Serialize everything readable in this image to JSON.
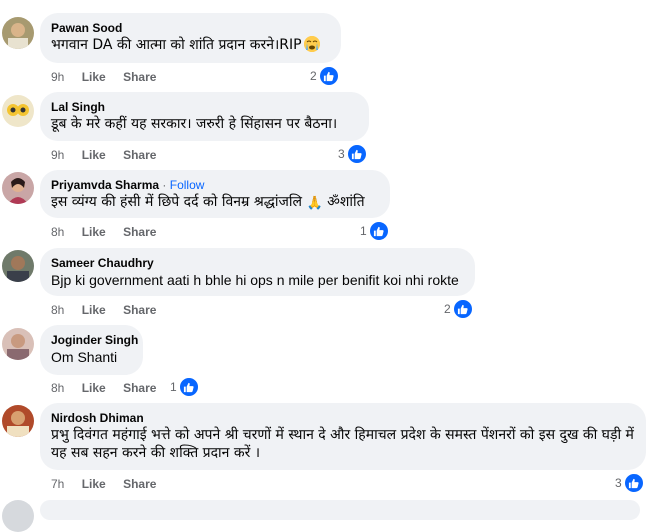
{
  "comments": [
    {
      "name": "Pawan Sood",
      "text": "भगवान DA की आत्मा को शांति प्रदान करने।RIP",
      "emoji": "crying-face",
      "time": "9h",
      "like": "Like",
      "share": "Share",
      "reactions": "2"
    },
    {
      "name": "Lal Singh",
      "text": "डूब के मरे कहीं यह सरकार। जरुरी हे सिंहासन पर बैठना।",
      "time": "9h",
      "like": "Like",
      "share": "Share",
      "reactions": "3"
    },
    {
      "name": "Priyamvda Sharma",
      "follow": "Follow",
      "dot": "·",
      "text": "इस व्यंग्य की हंसी में छिपे दर्द को विनम्र श्रद्धांजलि",
      "emoji_text": "🙏",
      "text2": "ॐशांति",
      "time": "8h",
      "like": "Like",
      "share": "Share",
      "reactions": "1"
    },
    {
      "name": "Sameer Chaudhry",
      "text": "Bjp ki government aati h bhle hi ops n mile per benifit koi nhi rokte",
      "time": "8h",
      "like": "Like",
      "share": "Share",
      "reactions": "2"
    },
    {
      "name": "Joginder Singh",
      "text": "Om Shanti",
      "time": "8h",
      "like": "Like",
      "share": "Share",
      "reactions": "1"
    },
    {
      "name": "Nirdosh Dhiman",
      "text": "प्रभु दिवंगत महंगाई भत्ते को अपने श्री चरणों में स्थान दे और हिमाचल प्रदेश के समस्त पेंशनरों को इस दुख की घड़ी में यह सब सहन करने की शक्ति प्रदान करें ।",
      "time": "7h",
      "like": "Like",
      "share": "Share",
      "reactions": "3"
    }
  ],
  "colors": {
    "bubble": "#f0f2f5",
    "like_blue": "#0866ff",
    "meta_gray": "#65676b"
  },
  "icons": {
    "reaction": "thumbs-up-icon"
  }
}
